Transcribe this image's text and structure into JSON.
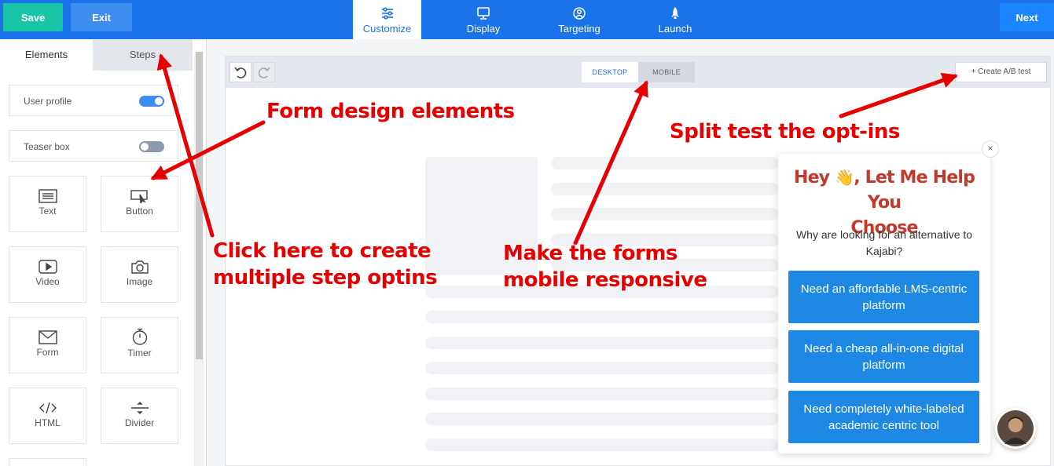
{
  "topbar": {
    "save_label": "Save",
    "exit_label": "Exit",
    "next_label": "Next",
    "tabs": [
      {
        "label": "Customize",
        "icon": "sliders-icon"
      },
      {
        "label": "Display",
        "icon": "monitor-icon"
      },
      {
        "label": "Targeting",
        "icon": "target-icon"
      },
      {
        "label": "Launch",
        "icon": "rocket-icon"
      }
    ],
    "active_tab": "Customize"
  },
  "left_panel": {
    "tabs": [
      "Elements",
      "Steps"
    ],
    "toggles": [
      {
        "label": "User profile",
        "on": true
      },
      {
        "label": "Teaser box",
        "on": false
      }
    ],
    "elements": [
      {
        "label": "Text",
        "icon": "text-icon"
      },
      {
        "label": "Button",
        "icon": "button-cursor-icon"
      },
      {
        "label": "Video",
        "icon": "video-icon"
      },
      {
        "label": "Image",
        "icon": "camera-icon"
      },
      {
        "label": "Form",
        "icon": "envelope-icon"
      },
      {
        "label": "Timer",
        "icon": "stopwatch-icon"
      },
      {
        "label": "HTML",
        "icon": "code-icon"
      },
      {
        "label": "Divider",
        "icon": "divider-icon"
      }
    ]
  },
  "canvas": {
    "view_options": [
      "DESKTOP",
      "MOBILE"
    ],
    "active_view": "DESKTOP",
    "ab_test_label": "+ Create A/B test"
  },
  "popup": {
    "close": "×",
    "title_line1_a": "Hey",
    "title_emoji": "👋",
    "title_line1_b": ", Let Me Help You",
    "title_line2": "Choose",
    "question": "Why are looking for an alternative to Kajabi?",
    "options": [
      "Need an affordable LMS-centric platform",
      "Need a cheap all-in-one digital platform",
      "Need completely white-labeled academic centric tool"
    ]
  },
  "annotations": {
    "form_design": "Form design elements",
    "split_test": "Split test the opt-ins",
    "steps_line1": "Click here to create",
    "steps_line2": "multiple step optins",
    "mobile_line1": "Make the forms",
    "mobile_line2": "mobile responsive"
  },
  "colors": {
    "topbar": "#1a73e8",
    "save": "#19c6a6",
    "option_button": "#1e88e5",
    "annotation": "#e60000",
    "popup_title": "#c0392b"
  }
}
